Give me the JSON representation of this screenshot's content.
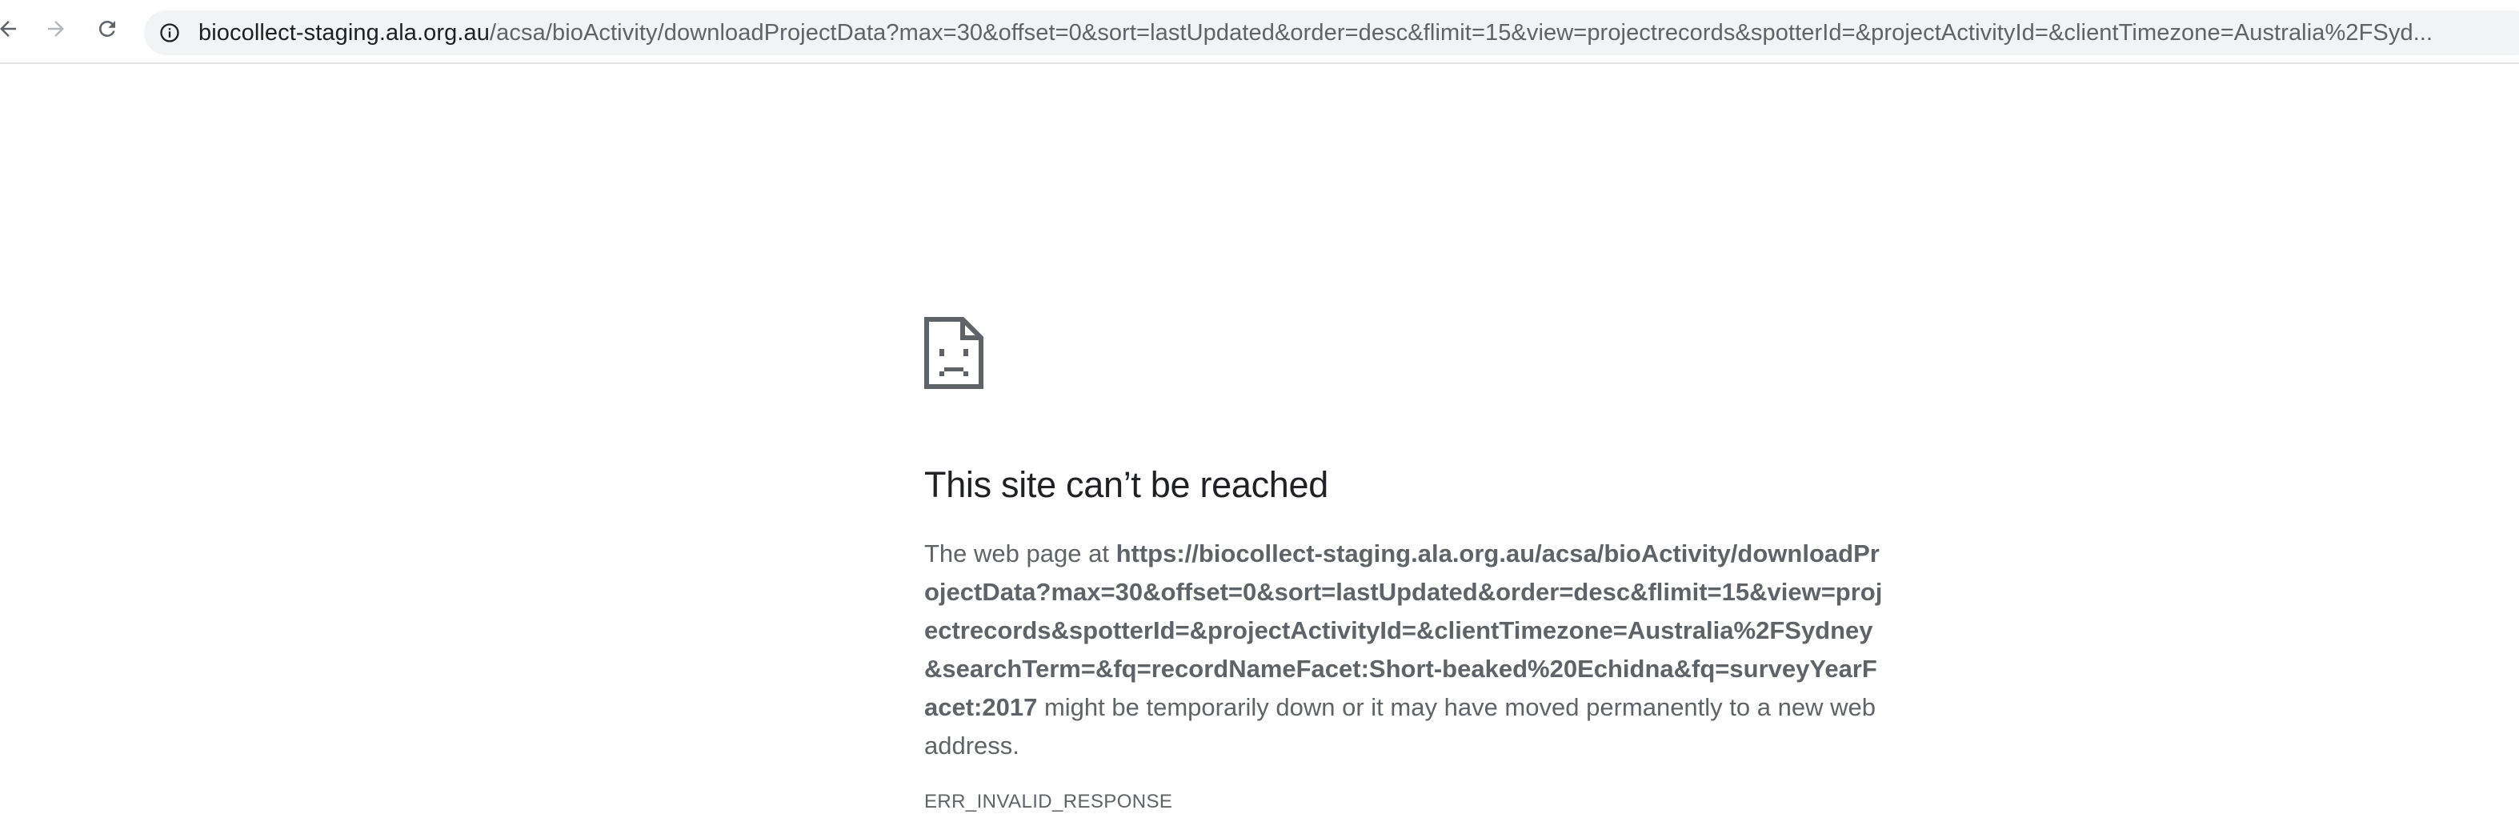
{
  "browser": {
    "url_host": "biocollect-staging.ala.org.au",
    "url_path": "/acsa/bioActivity/downloadProjectData?max=30&offset=0&sort=lastUpdated&order=desc&flimit=15&view=projectrecords&spotterId=&projectActivityId=&clientTimezone=Australia%2FSyd...",
    "icons": {
      "back": "arrow-left-icon",
      "forward": "arrow-right-icon",
      "reload": "reload-icon",
      "site_info": "info-circle-icon"
    }
  },
  "error_page": {
    "icon": "sad-page-icon",
    "title": "This site can’t be reached",
    "desc_prefix": "The web page at ",
    "desc_url": "https://biocollect-staging.ala.org.au/acsa/bioActivity/downloadProjectData?max=30&offset=0&sort=lastUpdated&order=desc&flimit=15&view=projectrecords&spotterId=&projectActivityId=&clientTimezone=Australia%2FSydney&searchTerm=&fq=recordNameFacet:Short-beaked%20Echidna&fq=surveyYearFacet:2017",
    "desc_suffix": " might be temporarily down or it may have moved permanently to a new web address.",
    "error_code": "ERR_INVALID_RESPONSE"
  },
  "colors": {
    "text_primary": "#202124",
    "text_secondary": "#5f6368",
    "omnibox_bg": "#f1f3f4",
    "icon": "#5f6368"
  }
}
